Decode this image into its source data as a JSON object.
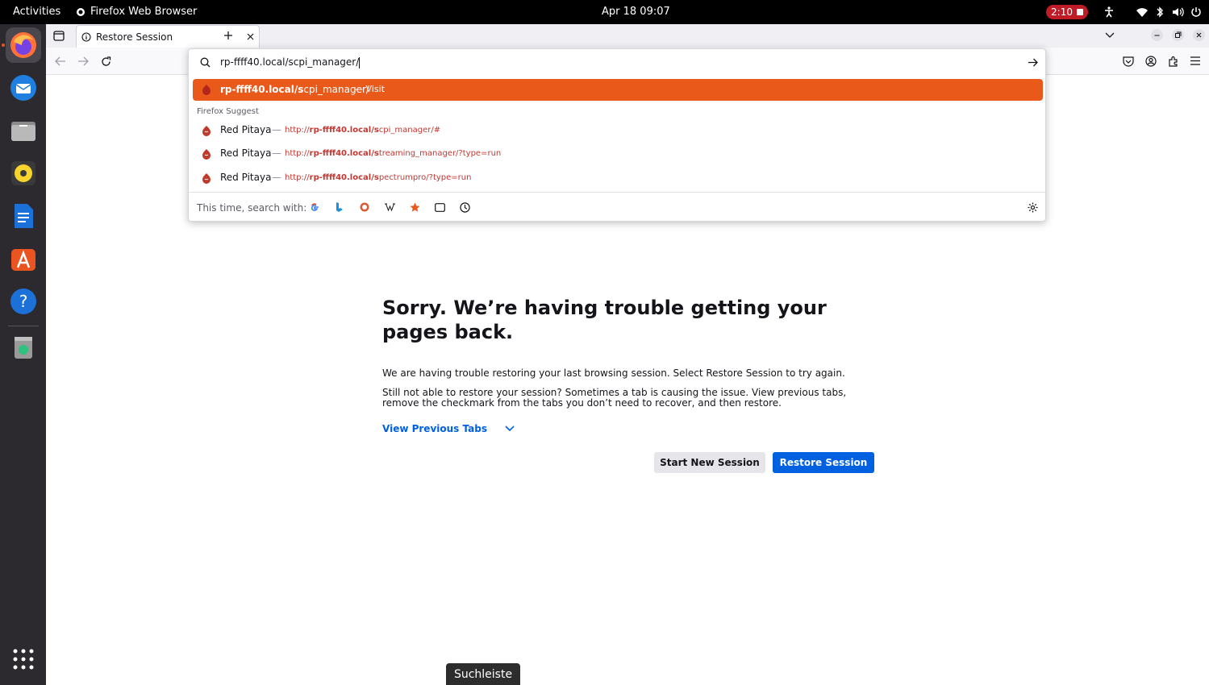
{
  "system": {
    "activities": "Activities",
    "app_name": "Firefox Web Browser",
    "clock": "Apr 18  09:07",
    "recording": "2:10"
  },
  "dock": {
    "apps": [
      "firefox",
      "thunderbird",
      "files",
      "rhythmbox",
      "libreoffice-writer",
      "app-center",
      "help",
      "trash",
      "show-apps"
    ]
  },
  "browser": {
    "tab_title": "Restore Session",
    "url_value": "rp-ffff40.local/scpi_manager/",
    "top_result": {
      "bold": "rp-ffff40.local/s",
      "rest": "cpi_manager/",
      "sep": "—",
      "action": "Visit"
    },
    "suggest_heading": "Firefox Suggest",
    "suggestions": [
      {
        "name": "Red Pitaya",
        "sep": "—",
        "prefix": "http://",
        "bold": "rp-ffff40.local/s",
        "rest": "cpi_manager/#"
      },
      {
        "name": "Red Pitaya",
        "sep": "—",
        "prefix": "http://",
        "bold": "rp-ffff40.local/s",
        "rest": "treaming_manager/?type=run"
      },
      {
        "name": "Red Pitaya",
        "sep": "—",
        "prefix": "http://",
        "bold": "rp-ffff40.local/s",
        "rest": "pectrumpro/?type=run"
      }
    ],
    "search_with_label": "This time, search with:",
    "engines": [
      "google",
      "bing",
      "duckduckgo",
      "wikipedia",
      "bookmarks",
      "tabs",
      "history"
    ]
  },
  "page": {
    "heading": "Sorry. We’re having trouble getting your pages back.",
    "para1": "We are having trouble restoring your last browsing session. Select Restore Session to try again.",
    "para2": "Still not able to restore your session? Sometimes a tab is causing the issue. View previous tabs, remove the checkmark from the tabs you don’t need to recover, and then restore.",
    "view_previous": "View Previous Tabs",
    "start_new": "Start New Session",
    "restore": "Restore Session"
  },
  "tooltip": "Suchleiste",
  "colors": {
    "accent_orange": "#e8591a",
    "primary_blue": "#0061e0",
    "link_blue": "#0061e0"
  }
}
